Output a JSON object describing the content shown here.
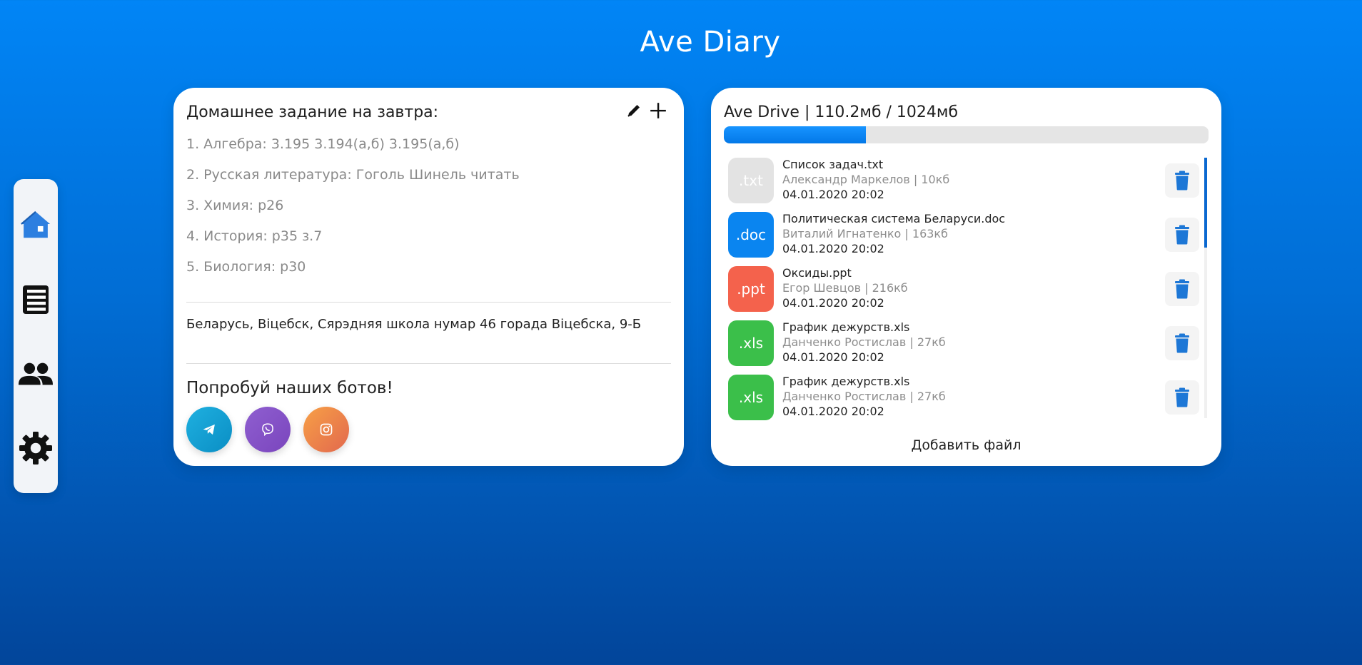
{
  "app": {
    "title": "Ave Diary"
  },
  "sidebar": {
    "items": [
      {
        "name": "home",
        "icon": "home-icon",
        "active": true
      },
      {
        "name": "diary",
        "icon": "notebook-icon"
      },
      {
        "name": "people",
        "icon": "people-icon"
      },
      {
        "name": "settings",
        "icon": "gear-icon"
      }
    ]
  },
  "homework": {
    "title": "Домашнее задание на завтра:",
    "edit_icon": "pencil-icon",
    "add_icon": "plus-icon",
    "items": [
      "1. Алгебра: 3.195 3.194(а,б) 3.195(а,б)",
      "2. Русская литература: Гоголь Шинель читать",
      "3. Химия: р26",
      "4. История: р35 з.7",
      "5. Биология: р30"
    ],
    "school": "Беларусь, Віцебск, Сярэдняя школа нумар 46 горада Віцебска, 9-Б",
    "bots_title": "Попробуй наших ботов!",
    "bots": [
      {
        "name": "telegram",
        "icon": "telegram-icon"
      },
      {
        "name": "viber",
        "icon": "viber-icon"
      },
      {
        "name": "instagram",
        "icon": "instagram-icon"
      }
    ]
  },
  "drive": {
    "title": "Ave Drive | 110.2мб / 1024мб",
    "used_mb": 110.2,
    "total_mb": 1024,
    "files": [
      {
        "ext": ".txt",
        "name": "Список задач.txt",
        "meta": "Александр Маркелов | 10кб",
        "date": "04.01.2020 20:02",
        "color": "#e3e3e3"
      },
      {
        "ext": ".doc",
        "name": "Политическая система Беларуси.doc",
        "meta": "Виталий Игнатенко | 163кб",
        "date": "04.01.2020 20:02",
        "color": "#0a85f0"
      },
      {
        "ext": ".ppt",
        "name": "Оксиды.ppt",
        "meta": "Егор Шевцов | 216кб",
        "date": "04.01.2020 20:02",
        "color": "#f4624c"
      },
      {
        "ext": ".xls",
        "name": "График дежурств.xls",
        "meta": "Данченко Ростислав | 27кб",
        "date": "04.01.2020 20:02",
        "color": "#3bbf4a"
      },
      {
        "ext": ".xls",
        "name": "График дежурств.xls",
        "meta": "Данченко Ростислав | 27кб",
        "date": "04.01.2020 20:02",
        "color": "#3bbf4a"
      }
    ],
    "add_file_label": "Добавить файл"
  },
  "colors": {
    "accent": "#0a85f0",
    "delete": "#1d77d6"
  }
}
